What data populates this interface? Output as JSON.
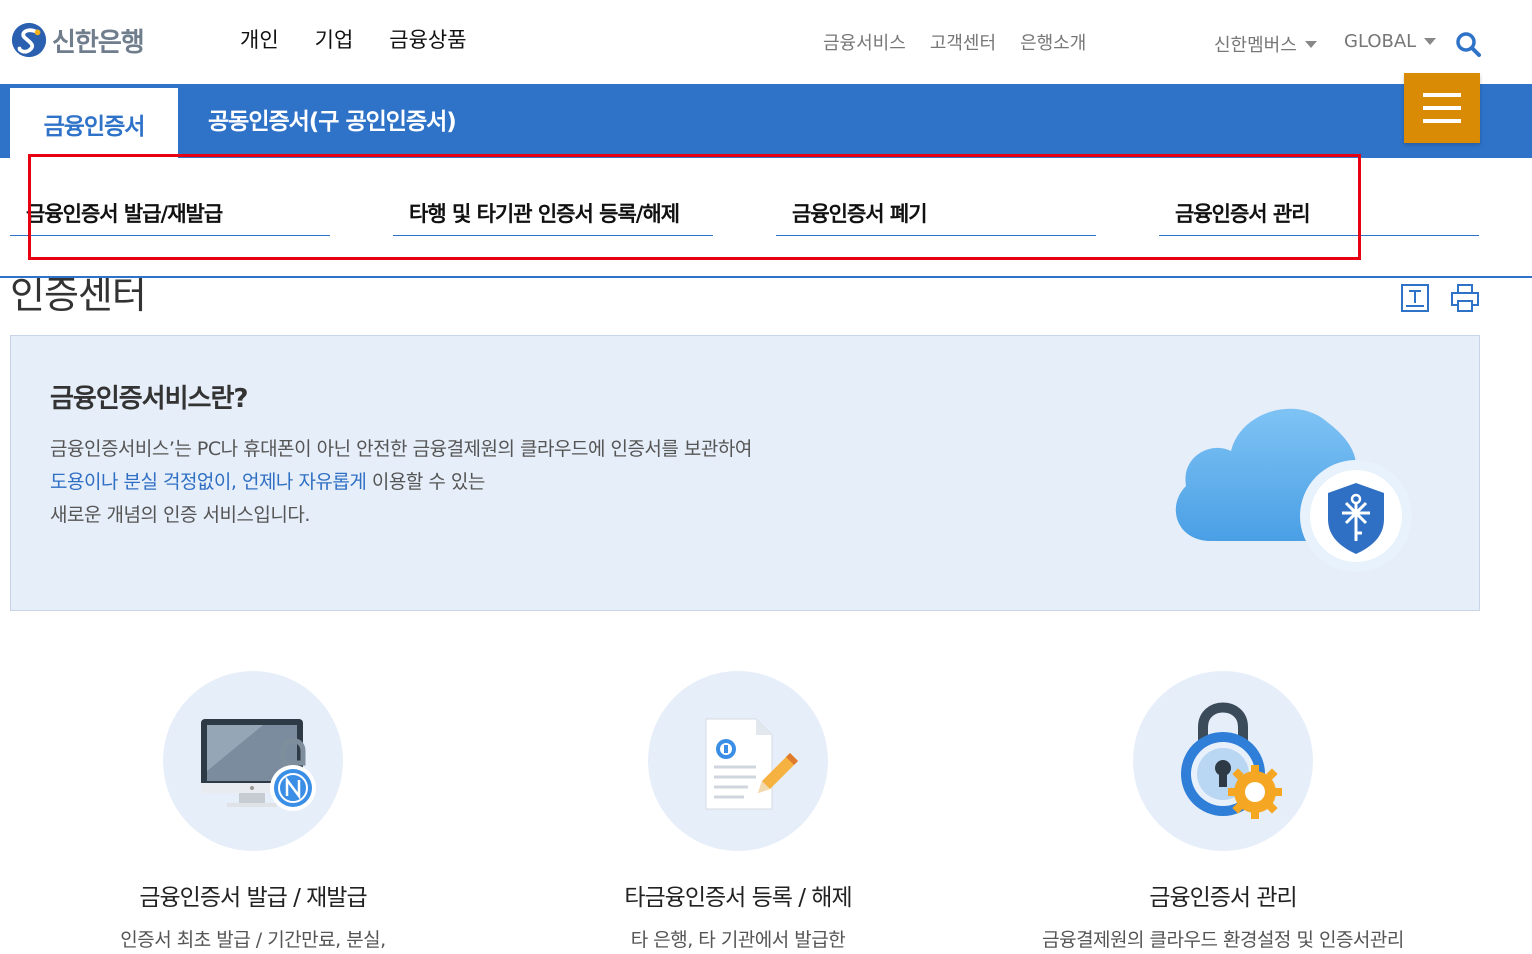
{
  "header": {
    "logo_text": "신한은행",
    "main_nav": [
      "개인",
      "기업",
      "금융상품"
    ],
    "util_nav": [
      "금융서비스",
      "고객센터",
      "은행소개"
    ],
    "member_label": "신한멤버스",
    "global_label": "GLOBAL"
  },
  "tabs": {
    "active": "금융인증서",
    "second": "공동인증서(구 공인인증서)"
  },
  "submenu": {
    "items": [
      "금융인증서 발급/재발급",
      "타행 및 타기관 인증서 등록/해제",
      "금융인증서 폐기",
      "금융인증서 관리"
    ]
  },
  "page": {
    "title": "인증센터"
  },
  "intro": {
    "heading": "금융인증서비스란?",
    "line1": "금융인증서비스’는 PC나 휴대폰이 아닌 안전한 금융결제원의 클라우드에 인증서를 보관하여",
    "line2_highlight": "도용이나 분실 걱정없이, 언제나 자유롭게",
    "line2_rest": " 이용할 수 있는",
    "line3": "새로운 개념의 인증 서비스입니다."
  },
  "services": [
    {
      "title": "금융인증서 발급 / 재발급",
      "desc": "인증서 최초 발급 / 기간만료, 분실,"
    },
    {
      "title": "타금융인증서 등록 / 해제",
      "desc": "타 은행, 타 기관에서 발급한"
    },
    {
      "title": "금융인증서 관리",
      "desc": "금융결제원의 클라우드 환경설정 및 인증서관리"
    }
  ],
  "colors": {
    "brand_blue": "#2f73c9",
    "menu_orange": "#d98b05",
    "highlight_red": "#e60012",
    "intro_bg": "#e6eef9"
  }
}
